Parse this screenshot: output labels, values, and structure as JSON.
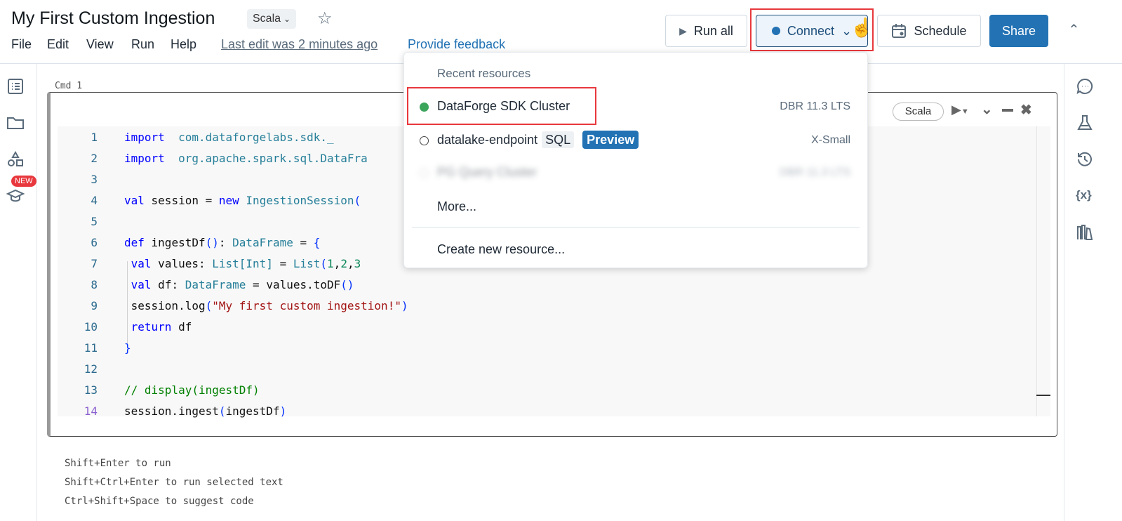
{
  "header": {
    "title": "My First Custom Ingestion",
    "language": "Scala",
    "menu": [
      "File",
      "Edit",
      "View",
      "Run",
      "Help"
    ],
    "last_edit": "Last edit was 2 minutes ago",
    "feedback": "Provide feedback"
  },
  "toolbar": {
    "run_all": "Run all",
    "connect": "Connect",
    "schedule": "Schedule",
    "share": "Share",
    "accent": "#2272b4",
    "highlight": "#e8383d"
  },
  "left_sidebar": {
    "icons": [
      "table-of-contents-icon",
      "folder-icon",
      "shapes-icon",
      "graduation-cap-icon"
    ],
    "new_badge": "NEW"
  },
  "right_sidebar": {
    "icons": [
      "comment-icon",
      "flask-icon",
      "history-icon",
      "variables-icon",
      "library-icon"
    ]
  },
  "cell": {
    "label": "Cmd 1",
    "language": "Scala",
    "lines": [
      [
        [
          "kw",
          "import"
        ],
        [
          "",
          "  "
        ],
        [
          "ty",
          "com.dataforgelabs.sdk._"
        ]
      ],
      [
        [
          "kw",
          "import"
        ],
        [
          "",
          "  "
        ],
        [
          "ty",
          "org.apache.spark.sql.DataFra"
        ]
      ],
      [],
      [
        [
          "kw",
          "val"
        ],
        [
          "",
          " session = "
        ],
        [
          "kw",
          "new"
        ],
        [
          "",
          " "
        ],
        [
          "ty",
          "IngestionSession"
        ],
        [
          "pa",
          "("
        ]
      ],
      [],
      [
        [
          "kw",
          "def"
        ],
        [
          "",
          " ingestDf"
        ],
        [
          "pa",
          "()"
        ],
        [
          "",
          ": "
        ],
        [
          "ty",
          "DataFrame"
        ],
        [
          "",
          " = "
        ],
        [
          "pa",
          "{"
        ]
      ],
      [
        [
          "",
          " "
        ],
        [
          "kw",
          "val"
        ],
        [
          "",
          " values: "
        ],
        [
          "ty",
          "List[Int]"
        ],
        [
          "",
          " = "
        ],
        [
          "ty",
          "List"
        ],
        [
          "pa",
          "("
        ],
        [
          "nm",
          "1"
        ],
        [
          "",
          ","
        ],
        [
          "nm",
          "2"
        ],
        [
          "",
          ","
        ],
        [
          "nm",
          "3"
        ]
      ],
      [
        [
          "",
          " "
        ],
        [
          "kw",
          "val"
        ],
        [
          "",
          " df: "
        ],
        [
          "ty",
          "DataFrame"
        ],
        [
          "",
          " = values.toDF"
        ],
        [
          "pa",
          "()"
        ]
      ],
      [
        [
          "",
          " session.log"
        ],
        [
          "pa",
          "("
        ],
        [
          "st",
          "\"My first custom ingestion!\""
        ],
        [
          "pa",
          ")"
        ]
      ],
      [
        [
          "",
          " "
        ],
        [
          "kw",
          "return"
        ],
        [
          "",
          " df"
        ]
      ],
      [
        [
          "pa",
          "}"
        ]
      ],
      [],
      [
        [
          "cm",
          "// display(ingestDf)"
        ]
      ],
      [
        [
          "",
          "session.ingest"
        ],
        [
          "pa",
          "("
        ],
        [
          "",
          "ingestDf"
        ],
        [
          "pa",
          ")"
        ]
      ]
    ]
  },
  "hints": [
    "Shift+Enter to run",
    "Shift+Ctrl+Enter to run selected text",
    "Ctrl+Shift+Space to suggest code"
  ],
  "dropdown": {
    "header": "Recent resources",
    "items": [
      {
        "name": "DataForge SDK Cluster",
        "detail": "DBR 11.3 LTS",
        "status": "running",
        "status_color": "#3ba55c"
      },
      {
        "name": "datalake-endpoint",
        "tag": "SQL",
        "badge": "Preview",
        "detail": "X-Small",
        "status": "stopped"
      },
      {
        "name": "PG Query Cluster",
        "detail": "DBR 11.3 LTS",
        "status": "blurred"
      }
    ],
    "more": "More...",
    "create": "Create new resource..."
  }
}
